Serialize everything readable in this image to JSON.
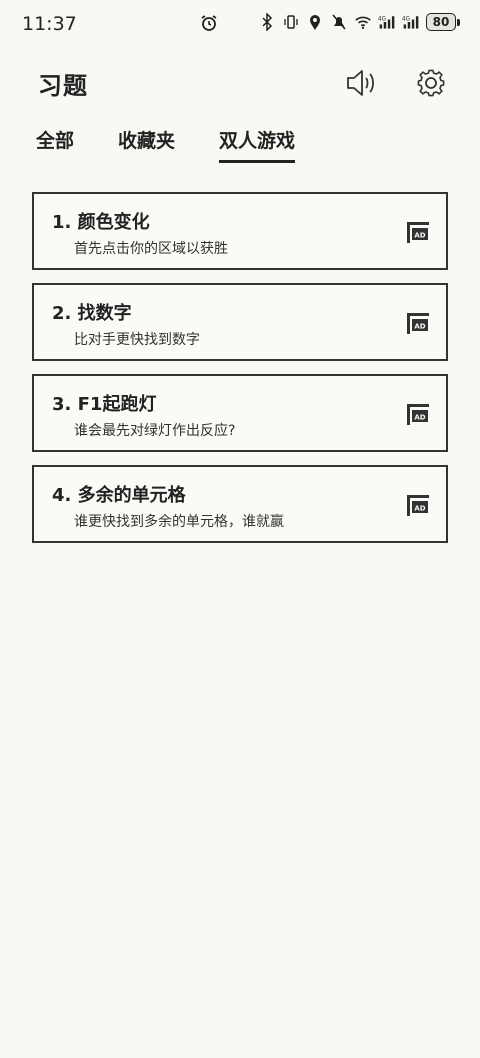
{
  "status_bar": {
    "time": "11:37",
    "battery": "80",
    "icons": [
      "alarm-icon",
      "bluetooth-icon",
      "vibrate-icon",
      "location-icon",
      "mute-icon",
      "wifi-icon",
      "signal-4g-icon",
      "signal-4g-icon"
    ]
  },
  "header": {
    "title": "习题",
    "sound_icon": "speaker-icon",
    "settings_icon": "gear-icon"
  },
  "tabs": [
    {
      "label": "全部",
      "active": false
    },
    {
      "label": "收藏夹",
      "active": false
    },
    {
      "label": "双人游戏",
      "active": true
    }
  ],
  "items": [
    {
      "title": "1. 颜色变化",
      "desc": "首先点击你的区域以获胜",
      "badge_text": "AD"
    },
    {
      "title": "2. 找数字",
      "desc": "比对手更快找到数字",
      "badge_text": "AD"
    },
    {
      "title": "3. F1起跑灯",
      "desc": "谁会最先对绿灯作出反应?",
      "badge_text": "AD"
    },
    {
      "title": "4. 多余的单元格",
      "desc": "谁更快找到多余的单元格，谁就赢",
      "badge_text": "AD"
    }
  ]
}
